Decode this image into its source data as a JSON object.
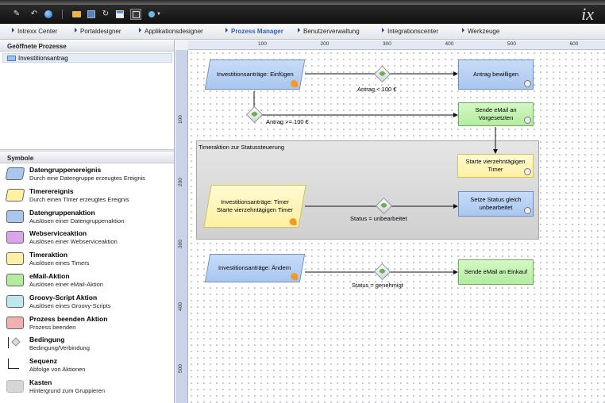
{
  "toolbar": {
    "icons": [
      "tools-icon",
      "back-icon",
      "globe-icon",
      "folder-open-icon",
      "save-icon",
      "refresh-icon",
      "window-icon",
      "layout-icon",
      "user-icon"
    ],
    "logo": "ix"
  },
  "nav": {
    "items": [
      {
        "label": "Intrexx Center",
        "active": false
      },
      {
        "label": "Portaldesigner",
        "active": false
      },
      {
        "label": "Applikationsdesigner",
        "active": false
      },
      {
        "label": "Prozess Manager",
        "active": true
      },
      {
        "label": "Benutzerverwaltung",
        "active": false
      },
      {
        "label": "Integrationscenter",
        "active": false
      },
      {
        "label": "Werkzeuge",
        "active": false
      }
    ]
  },
  "open_processes": {
    "title": "Geöffnete Prozesse",
    "items": [
      "Investitionsantrag"
    ]
  },
  "symbols": {
    "title": "Symbole",
    "items": [
      {
        "title": "Datengruppenereignis",
        "desc": "Durch eine Datengruppe erzeugtes Ereignis",
        "icon": "datagroup-event-icon",
        "color": "#a9c6ef"
      },
      {
        "title": "Timerereignis",
        "desc": "Durch einen Timer erzeugtes Ereignis",
        "icon": "timer-event-icon",
        "color": "#fff0a2"
      },
      {
        "title": "Datengruppenaktion",
        "desc": "Auslösen einer Datengruppenaktion",
        "icon": "datagroup-action-icon",
        "color": "#a9c6ef"
      },
      {
        "title": "Webserviceaktion",
        "desc": "Auslösen einer Webserviceaktion",
        "icon": "webservice-action-icon",
        "color": "#d9a6ec"
      },
      {
        "title": "Timeraktion",
        "desc": "Auslösen eines Timers",
        "icon": "timer-action-icon",
        "color": "#fff0a2"
      },
      {
        "title": "eMail-Aktion",
        "desc": "Auslösen einer eMail-Aktion",
        "icon": "email-action-icon",
        "color": "#b3ec9f"
      },
      {
        "title": "Groovy-Script Aktion",
        "desc": "Auslösen eines Groovy-Scripts",
        "icon": "groovy-action-icon",
        "color": "#bfe7ee"
      },
      {
        "title": "Prozess beenden Aktion",
        "desc": "Prozess beenden",
        "icon": "end-process-icon",
        "color": "#f3b0b0"
      },
      {
        "title": "Bedingung",
        "desc": "Bedingung/Verbindung",
        "icon": "condition-icon",
        "color": "none"
      },
      {
        "title": "Sequenz",
        "desc": "Abfolge von Aktionen",
        "icon": "sequence-icon",
        "color": "none"
      },
      {
        "title": "Kasten",
        "desc": "Hintergrund zum Gruppieren",
        "icon": "box-icon",
        "color": "#d6d6d6"
      }
    ]
  },
  "ruler": {
    "top": [
      "100",
      "200",
      "300",
      "400",
      "500",
      "600"
    ],
    "left": [
      "100",
      "200",
      "300",
      "400",
      "500"
    ]
  },
  "diagram": {
    "group_title": "Timeraktion zur Statussteuerung",
    "nodes": {
      "einfuegen": "Investitionsanträge: Einfügen",
      "bewilligen": "Antrag bewilligen",
      "email_vorgesetzte": "Sende eMail an Vorgesetzten",
      "timer_start": "Starte vierzehntägigen Timer",
      "timer_event": "Investitionsanträge: Timer Starte vierzehntägigen Timer",
      "status_unbearbeitet": "Setze Status gleich unbearbeitet",
      "aendern": "Investitionsanträge: Ändern",
      "email_einkauf": "Sende eMail an Einkauf"
    },
    "conditions": {
      "lt100": "Antrag < 100 €",
      "ge100": "Antrag >= 100 €",
      "unbearbeitet": "Status = unbearbeitet",
      "genehmigt": "Status = genehmigt"
    }
  }
}
